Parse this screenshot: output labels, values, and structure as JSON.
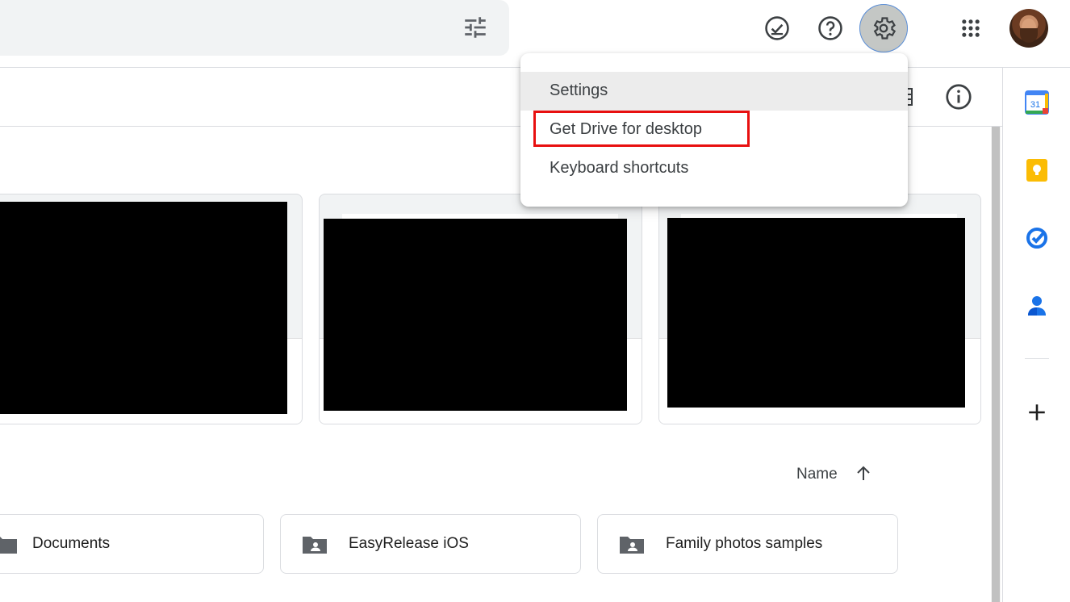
{
  "settings_menu": {
    "items": [
      {
        "label": "Settings",
        "highlighted": true
      },
      {
        "label": "Get Drive for desktop",
        "annotated": true
      },
      {
        "label": "Keyboard shortcuts"
      }
    ],
    "annotation_color": "#e81010"
  },
  "top_bar": {
    "icons": [
      "tune-icon",
      "ready-for-offline-icon",
      "help-icon",
      "settings-gear-icon",
      "apps-grid-icon",
      "avatar"
    ]
  },
  "toolbar": {
    "icons": [
      "grid-view-icon",
      "info-icon"
    ]
  },
  "side_panel": {
    "apps": [
      "calendar-icon",
      "keep-icon",
      "tasks-icon",
      "contacts-icon"
    ],
    "calendar_day": "31",
    "add_icon": "plus-icon"
  },
  "sort": {
    "label": "Name",
    "direction": "ascending"
  },
  "folders": [
    {
      "name": "Documents",
      "shared": false
    },
    {
      "name": "EasyRelease iOS",
      "shared": true
    },
    {
      "name": "Family photos samples",
      "shared": true
    }
  ],
  "colors": {
    "accent_blue": "#1a73e8",
    "highlight_gray": "#ececec",
    "annotation_red": "#e81010"
  }
}
